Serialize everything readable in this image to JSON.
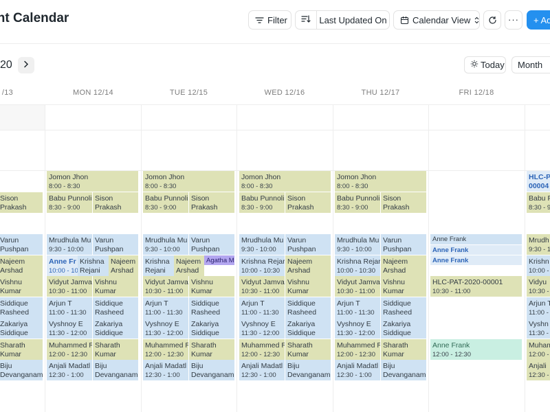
{
  "header": {
    "title": "tment Calendar",
    "filter_label": "Filter",
    "sort_label": "Last Updated On",
    "view_label": "Calendar View",
    "add_label": "+ Ad"
  },
  "toolbar": {
    "month_label": "20",
    "today_label": "Today",
    "month_view_label": "Month"
  },
  "days": [
    "/13",
    "MON 12/14",
    "TUE 12/15",
    "WED 12/16",
    "THU 12/17",
    "FRI 12/18"
  ],
  "colors": {
    "olive": "#dee2b6",
    "blue": "#cfe2f3",
    "teal": "#c9efe2",
    "purple": "#b3a6f0",
    "primary": "#2490ef"
  },
  "events": {
    "sun": [
      {
        "title": "Sison",
        "sub": "Prakash"
      },
      {
        "title": "Varun",
        "sub": "Pushpan"
      },
      {
        "title": "Najeem",
        "sub": "Arshad"
      },
      {
        "title": "Vishnu",
        "sub": "Kumar"
      },
      {
        "title": "Siddique",
        "sub": "Rasheed"
      },
      {
        "title": "Zakariya",
        "sub": "Siddique"
      },
      {
        "title": "Sharath",
        "sub": "Kumar"
      },
      {
        "title": "Biju",
        "sub": "Devanganam"
      }
    ],
    "mon": [
      {
        "title": "Jomon Jhon",
        "sub": "8:00 - 8:30"
      },
      {
        "title": "Babu Punnoli",
        "sub": "8:30 - 9:00"
      },
      {
        "title": "Sison",
        "sub": "Prakash"
      },
      {
        "title": "Mrudhula Mu",
        "sub": "9:30 - 10:00"
      },
      {
        "title": "Varun",
        "sub": "Pushpan"
      },
      {
        "title": "Anne Fr",
        "sub": "10:00 - 10"
      },
      {
        "title": "Krishna",
        "sub": "Rejani"
      },
      {
        "title": "Najeem",
        "sub": "Arshad"
      },
      {
        "title": "Vidyut Jamva",
        "sub": "10:30 - 11:00"
      },
      {
        "title": "Vishnu",
        "sub": "Kumar"
      },
      {
        "title": "Arjun T",
        "sub": "11:00 - 11:30"
      },
      {
        "title": "Siddique",
        "sub": "Rasheed"
      },
      {
        "title": "Vyshnoy E",
        "sub": "11:30 - 12:00"
      },
      {
        "title": "Zakariya",
        "sub": "Siddique"
      },
      {
        "title": "Muhammed R",
        "sub": "12:00 - 12:30"
      },
      {
        "title": "Sharath",
        "sub": "Kumar"
      },
      {
        "title": "Anjali Madatl",
        "sub": "12:30 - 1:00"
      },
      {
        "title": "Biju",
        "sub": "Devanganam"
      }
    ],
    "tue": [
      {
        "title": "Jomon Jhon",
        "sub": "8:00 - 8:30"
      },
      {
        "title": "Babu Punnoli",
        "sub": "8:30 - 9:00"
      },
      {
        "title": "Sison",
        "sub": "Prakash"
      },
      {
        "title": "Mrudhula Mu",
        "sub": "9:30 - 10:00"
      },
      {
        "title": "Varun",
        "sub": "Pushpan"
      },
      {
        "title": "Krishna",
        "sub": "Rejani"
      },
      {
        "title": "Najeem",
        "sub": "Arshad"
      },
      {
        "title": "Agatha Ma",
        "sub": ""
      },
      {
        "title": "Vidyut Jamva",
        "sub": "10:30 - 11:00"
      },
      {
        "title": "Vishnu",
        "sub": "Kumar"
      },
      {
        "title": "Arjun T",
        "sub": "11:00 - 11:30"
      },
      {
        "title": "Siddique",
        "sub": "Rasheed"
      },
      {
        "title": "Vyshnoy E",
        "sub": "11:30 - 12:00"
      },
      {
        "title": "Zakariya",
        "sub": "Siddique"
      },
      {
        "title": "Muhammed R",
        "sub": "12:00 - 12:30"
      },
      {
        "title": "Sharath",
        "sub": "Kumar"
      },
      {
        "title": "Anjali Madatl",
        "sub": "12:30 - 1:00"
      },
      {
        "title": "Biju",
        "sub": "Devanganam"
      }
    ],
    "wed": [
      {
        "title": "Jomon Jhon",
        "sub": "8:00 - 8:30"
      },
      {
        "title": "Babu Punnoli",
        "sub": "8:30 - 9:00"
      },
      {
        "title": "Sison",
        "sub": "Prakash"
      },
      {
        "title": "Mrudhula Mu",
        "sub": "9:30 - 10:00"
      },
      {
        "title": "Varun",
        "sub": "Pushpan"
      },
      {
        "title": "Krishna Rejar",
        "sub": "10:00 - 10:30"
      },
      {
        "title": "Najeem",
        "sub": "Arshad"
      },
      {
        "title": "Vidyut Jamva",
        "sub": "10:30 - 11:00"
      },
      {
        "title": "Vishnu",
        "sub": "Kumar"
      },
      {
        "title": "Arjun T",
        "sub": "11:00 - 11:30"
      },
      {
        "title": "Siddique",
        "sub": "Rasheed"
      },
      {
        "title": "Vyshnoy E",
        "sub": "11:30 - 12:00"
      },
      {
        "title": "Zakariya",
        "sub": "Siddique"
      },
      {
        "title": "Muhammed R",
        "sub": "12:00 - 12:30"
      },
      {
        "title": "Sharath",
        "sub": "Kumar"
      },
      {
        "title": "Anjali Madatl",
        "sub": "12:30 - 1:00"
      },
      {
        "title": "Biju",
        "sub": "Devanganam"
      }
    ],
    "thu": [
      {
        "title": "Jomon Jhon",
        "sub": "8:00 - 8:30"
      },
      {
        "title": "Babu Punnoli",
        "sub": "8:30 - 9:00"
      },
      {
        "title": "Sison",
        "sub": "Prakash"
      },
      {
        "title": "Mrudhula Mu",
        "sub": "9:30 - 10:00"
      },
      {
        "title": "Varun",
        "sub": "Pushpan"
      },
      {
        "title": "Krishna Rejar",
        "sub": "10:00 - 10:30"
      },
      {
        "title": "Najeem",
        "sub": "Arshad"
      },
      {
        "title": "Vidyut Jamva",
        "sub": "10:30 - 11:00"
      },
      {
        "title": "Vishnu",
        "sub": "Kumar"
      },
      {
        "title": "Arjun T",
        "sub": "11:00 - 11:30"
      },
      {
        "title": "Siddique",
        "sub": "Rasheed"
      },
      {
        "title": "Vyshnoy E",
        "sub": "11:30 - 12:00"
      },
      {
        "title": "Zakariya",
        "sub": "Siddique"
      },
      {
        "title": "Muhammed R",
        "sub": "12:00 - 12:30"
      },
      {
        "title": "Sharath",
        "sub": "Kumar"
      },
      {
        "title": "Anjali Madatl",
        "sub": "12:30 - 1:00"
      },
      {
        "title": "Biju",
        "sub": "Devanganam"
      }
    ],
    "fri": [
      {
        "title": "Anne Frank",
        "sub": ""
      },
      {
        "title": "Anne Frank",
        "sub": ""
      },
      {
        "title": "Anne Frank",
        "sub": ""
      },
      {
        "title": "HLC-PAT-2020-00001",
        "sub": "10:30 - 11:00"
      },
      {
        "title": "Anne Frank",
        "sub": "12:00 - 12:30"
      }
    ],
    "sat": [
      {
        "title": "HLC-P",
        "sub": "00004"
      },
      {
        "title": "Babu P",
        "sub": "8:30 - 9"
      },
      {
        "title": "Mrudh",
        "sub": "9:30 - 1"
      },
      {
        "title": "Krishn",
        "sub": "10:00 - 1"
      },
      {
        "title": "Vidyu",
        "sub": "10:30 - 1"
      },
      {
        "title": "Arjun T",
        "sub": "11:00 - 1"
      },
      {
        "title": "Vyshn",
        "sub": "11:30 - 1"
      },
      {
        "title": "Muham",
        "sub": "12:00 - 1"
      },
      {
        "title": "Anjali",
        "sub": "12:30 - 1"
      }
    ]
  }
}
